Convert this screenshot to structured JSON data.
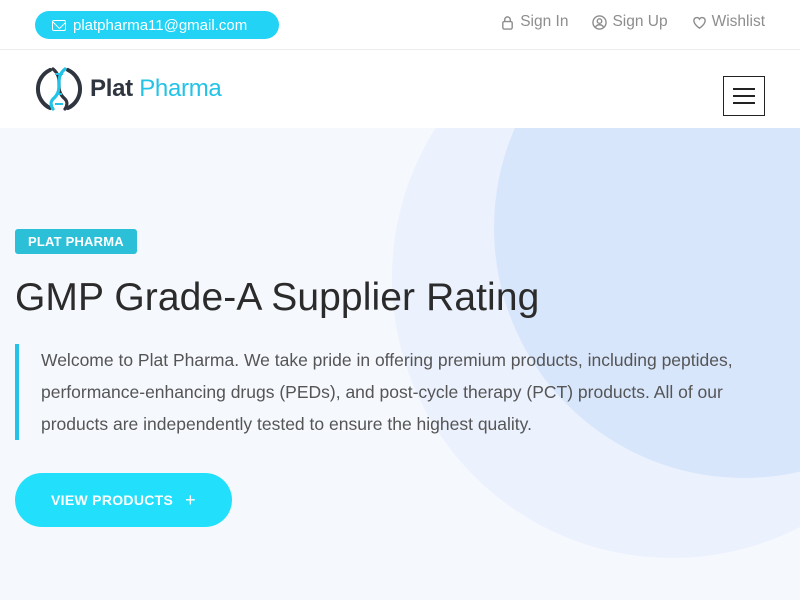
{
  "topbar": {
    "email": "platpharma11@gmail.com",
    "links": [
      {
        "label": "Sign In",
        "icon": "lock-icon"
      },
      {
        "label": "Sign Up",
        "icon": "user-circle-icon"
      },
      {
        "label": "Wishlist",
        "icon": "heart-icon"
      }
    ]
  },
  "header": {
    "logo_bold": "Plat",
    "logo_light": "Pharma"
  },
  "hero": {
    "tag": "PLAT PHARMA",
    "headline": "GMP Grade-A Supplier Rating",
    "intro": "Welcome to Plat Pharma. We take pride in offering premium products, including peptides, performance-enhancing drugs (PEDs), and post-cycle therapy (PCT) products. All of our products are independently tested to ensure the highest quality.",
    "cta_label": "VIEW PRODUCTS",
    "cta_icon": "+"
  },
  "colors": {
    "accent": "#22d3f5",
    "tag": "#2bbfd8",
    "button": "#22e0fb",
    "hero_bg": "#f5f8fd"
  }
}
